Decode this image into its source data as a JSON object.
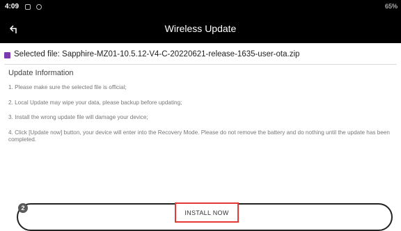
{
  "status_bar": {
    "time": "4:09",
    "battery": "65%"
  },
  "header": {
    "back_icon": "back-arrow-icon",
    "title": "Wireless Update"
  },
  "selected_file": {
    "icon": "file-icon",
    "icon_color": "#7b3bb0",
    "text": "Selected file: Sapphire-MZ01-10.5.12-V4-C-20220621-release-1635-user-ota.zip"
  },
  "update_info": {
    "header": "Update Information",
    "steps": [
      "1. Please make sure the selected file is official;",
      "2. Local Update may wipe your data, please backup before updating;",
      "3. Install the wrong update file will damage your device;",
      "4. Click [Update now] button, your device will enter into the Recovery Mode. Please do not remove the battery and do nothing until the update has been completed."
    ]
  },
  "install": {
    "label": "INSTALL NOW",
    "highlight_color": "#e53935",
    "badge": "2"
  }
}
